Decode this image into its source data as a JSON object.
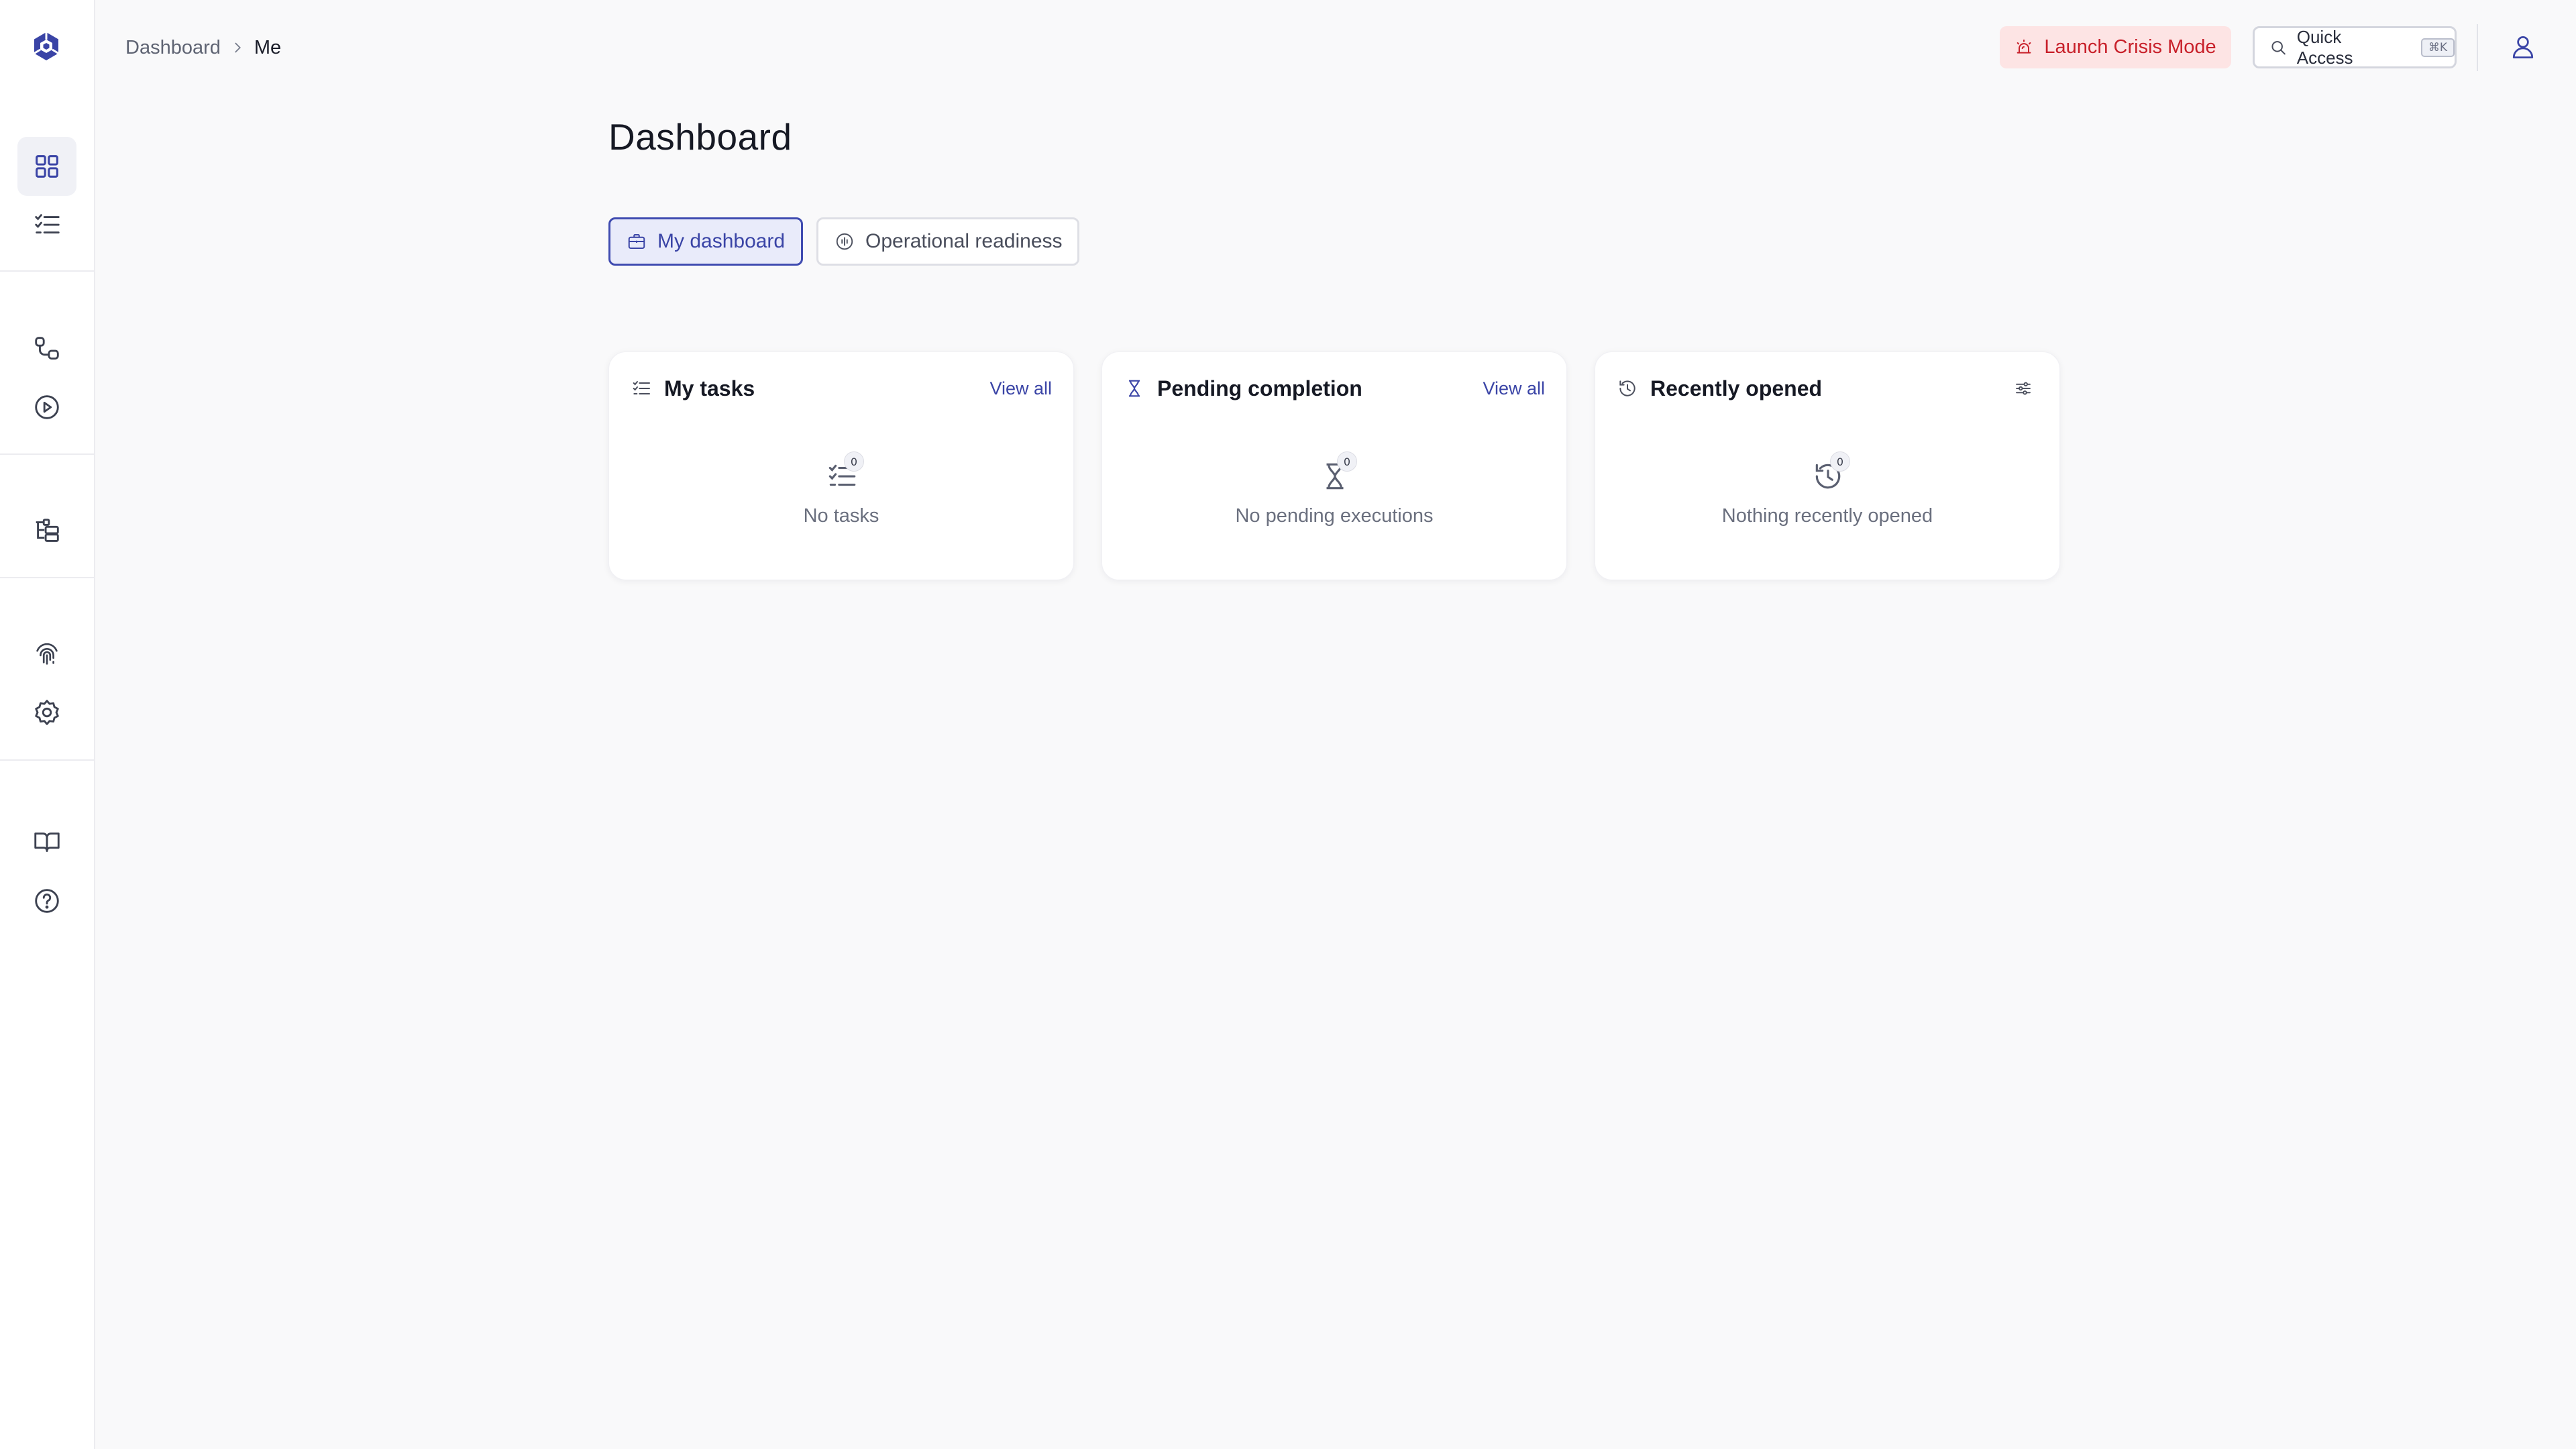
{
  "header": {
    "breadcrumb": [
      "Dashboard",
      "Me"
    ],
    "crisis_button": "Launch Crisis Mode",
    "quick_access": {
      "label": "Quick Access",
      "shortcut": "⌘K"
    }
  },
  "page": {
    "title": "Dashboard",
    "tabs": [
      {
        "label": "My dashboard",
        "active": true
      },
      {
        "label": "Operational readiness",
        "active": false
      }
    ]
  },
  "cards": [
    {
      "title": "My tasks",
      "action": "View all",
      "count": "0",
      "empty_text": "No tasks"
    },
    {
      "title": "Pending completion",
      "action": "View all",
      "count": "0",
      "empty_text": "No pending executions"
    },
    {
      "title": "Recently opened",
      "count": "0",
      "empty_text": "Nothing recently opened"
    }
  ],
  "colors": {
    "accent": "#3a44a6",
    "crisis_bg": "#fde4e4",
    "crisis_text": "#c8202a",
    "background": "#f9f9fa"
  },
  "sidebar": {
    "icons": [
      "grid-icon",
      "checklist-icon",
      "workflow-icon",
      "play-circle-icon",
      "hierarchy-icon",
      "fingerprint-icon",
      "gear-icon",
      "book-icon",
      "help-icon"
    ]
  }
}
